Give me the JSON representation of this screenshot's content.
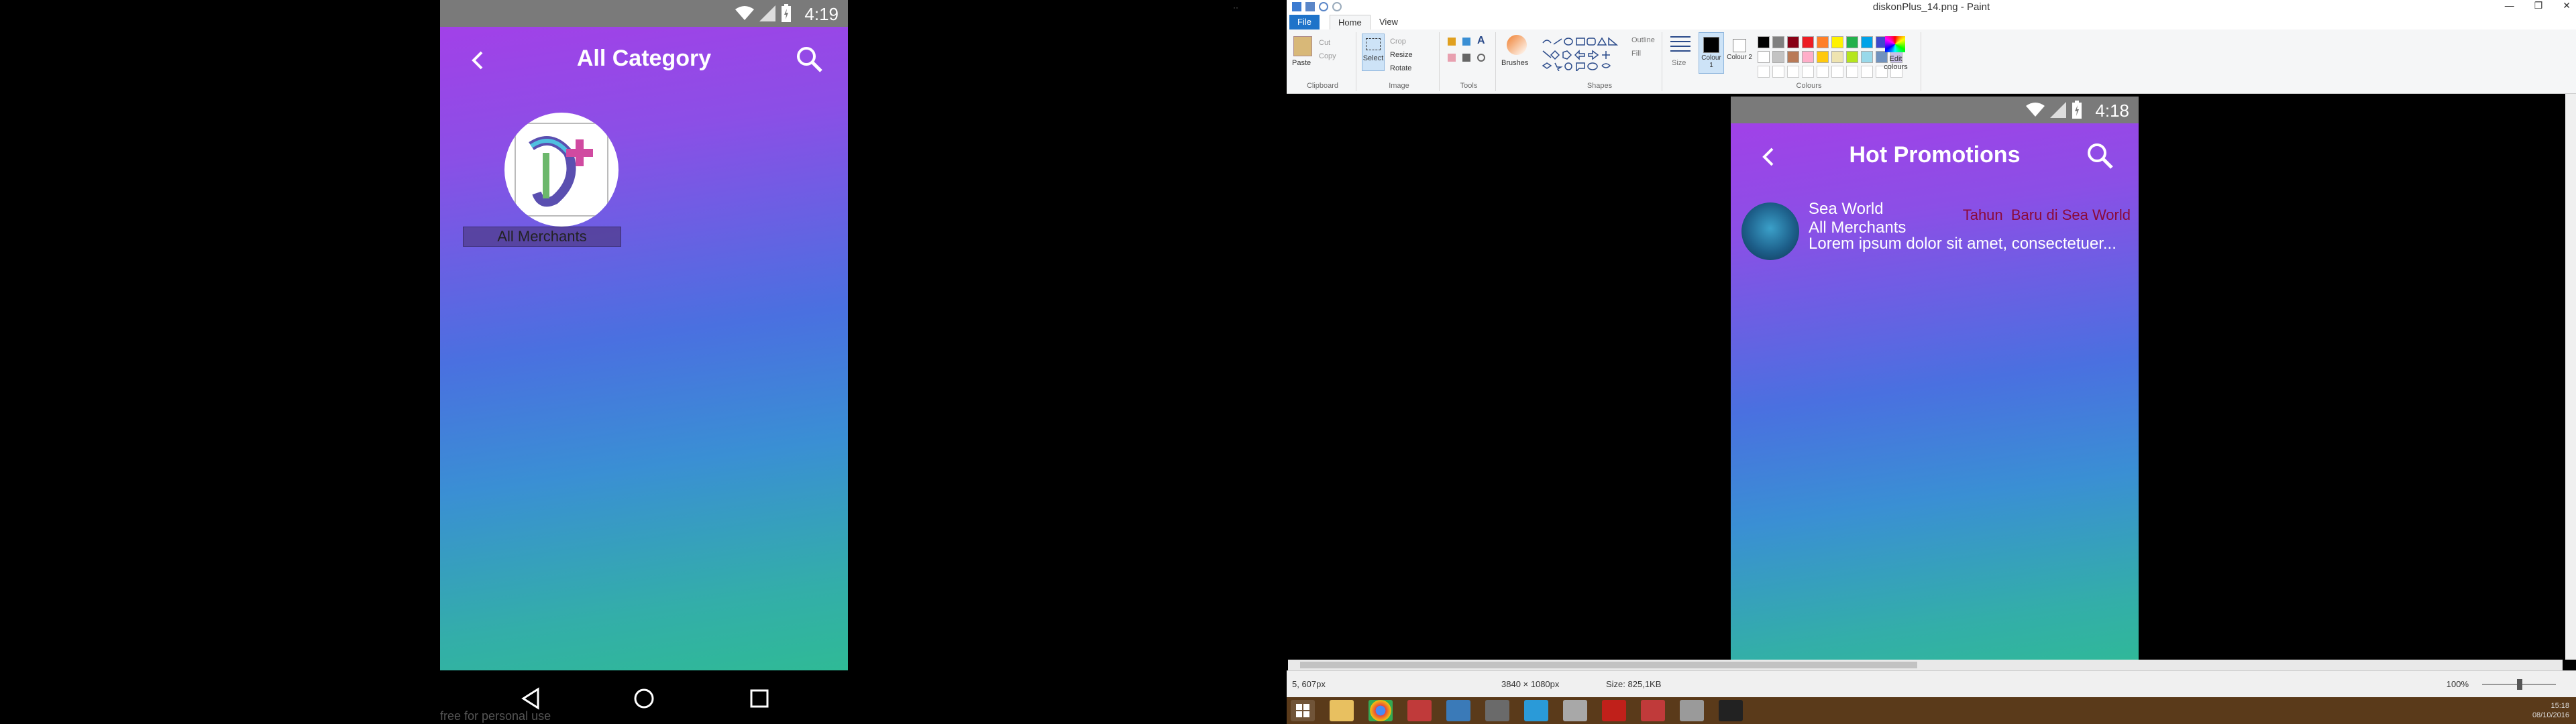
{
  "left_phone": {
    "status": {
      "time": "4:19"
    },
    "appbar": {
      "title": "All Category"
    },
    "categories": [
      {
        "label": "All Merchants"
      }
    ],
    "watermark": "free for personal use"
  },
  "paint": {
    "window_title": "diskonPlus_14.png - Paint",
    "menu": {
      "file": "File",
      "home": "Home",
      "view": "View"
    },
    "ribbon": {
      "clipboard": {
        "paste": "Paste",
        "cut": "Cut",
        "copy": "Copy",
        "group": "Clipboard"
      },
      "image": {
        "select": "Select",
        "crop": "Crop",
        "resize": "Resize",
        "rotate": "Rotate",
        "group": "Image"
      },
      "tools": {
        "group": "Tools"
      },
      "brushes": "Brushes",
      "shapes": {
        "outline": "Outline",
        "fill": "Fill",
        "group": "Shapes"
      },
      "size": "Size",
      "colour1": "Colour 1",
      "colour2": "Colour 2",
      "colours_group": "Colours",
      "edit_colours": "Edit colours",
      "palette": [
        "#000000",
        "#7f7f7f",
        "#880015",
        "#ed1c24",
        "#ff7f27",
        "#fff200",
        "#22b14c",
        "#00a2e8",
        "#3f48cc",
        "#a349a4",
        "#ffffff",
        "#c3c3c3",
        "#b97a57",
        "#ffaec9",
        "#ffc90e",
        "#efe4b0",
        "#b5e61d",
        "#99d9ea",
        "#7092be",
        "#c8bfe7"
      ]
    },
    "inner_app": {
      "status": {
        "time": "4:18"
      },
      "appbar": {
        "title": "Hot Promotions"
      },
      "promotion": {
        "merchant": "Sea World",
        "category": "All Merchants",
        "description": "Lorem ipsum dolor sit amet, consectetuer...",
        "name": "Tahun  Baru di Sea World"
      }
    },
    "statusbar": {
      "position": "5, 607px",
      "dimensions": "3840 × 1080px",
      "size": "Size: 825,1KB",
      "zoom": "100%"
    }
  },
  "taskbar": {
    "clock_time": "15:18",
    "clock_date": "08/10/2016"
  }
}
